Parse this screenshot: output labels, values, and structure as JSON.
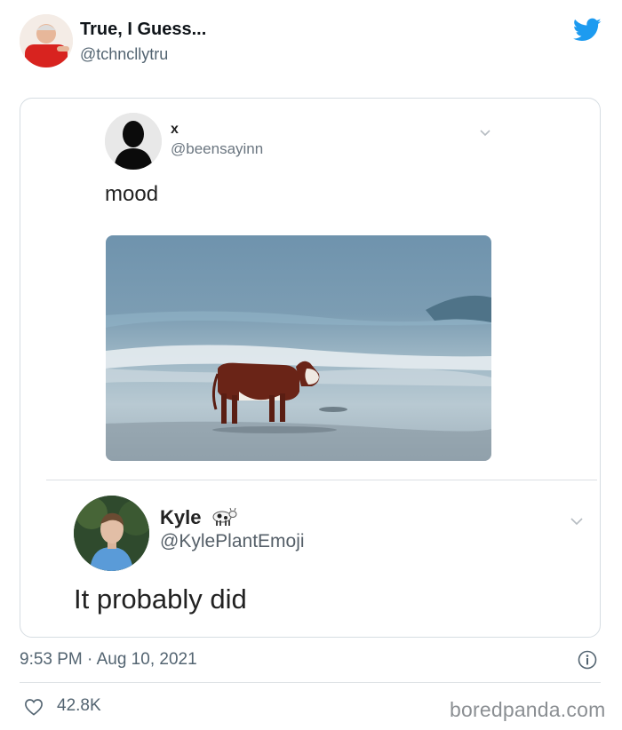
{
  "tweet": {
    "author_name": "True, I Guess...",
    "author_handle": "@tchncllytru",
    "timestamp": "9:53 PM · Aug 10, 2021",
    "likes": "42.8K"
  },
  "quoted": {
    "name": "x",
    "handle": "@beensayinn",
    "text": "mood"
  },
  "reply": {
    "name": "Kyle",
    "handle": "@KylePlantEmoji",
    "text": "It probably did"
  },
  "watermark": "boredpanda.com",
  "icons": {
    "brand": "twitter-bird-icon",
    "more": "chevron-down-icon",
    "info": "info-icon",
    "like": "heart-icon",
    "emoji": "cow-emoji-icon"
  },
  "colors": {
    "twitter_blue": "#1d9bf0",
    "secondary_text": "#536471",
    "border": "#d6dde2"
  }
}
